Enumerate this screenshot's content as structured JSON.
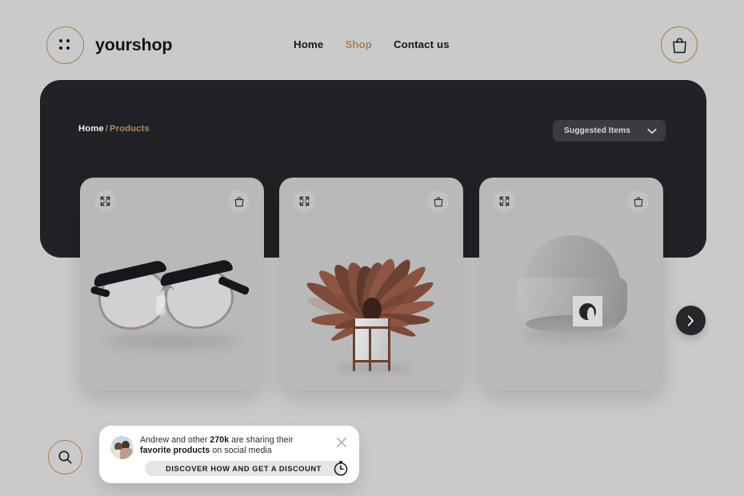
{
  "header": {
    "brand_name": "yourshop",
    "logo_icon": "four-dots-circle-icon",
    "nav": [
      {
        "label": "Home",
        "active": false
      },
      {
        "label": "Shop",
        "active": true
      },
      {
        "label": "Contact us",
        "active": false
      }
    ],
    "cart_icon": "shopping-bag-icon"
  },
  "panel": {
    "breadcrumb": {
      "home": "Home",
      "separator": "/",
      "current": "Products"
    },
    "sort_dropdown": {
      "selected": "Suggested Items",
      "chevron_icon": "chevron-down-icon"
    }
  },
  "products": [
    {
      "name": "eyeglasses",
      "expand_icon": "expand-arrows-icon",
      "cart_icon": "shopping-bag-icon"
    },
    {
      "name": "potted-plant",
      "expand_icon": "expand-arrows-icon",
      "cart_icon": "shopping-bag-icon"
    },
    {
      "name": "knit-beanie",
      "expand_icon": "expand-arrows-icon",
      "cart_icon": "shopping-bag-icon"
    }
  ],
  "carousel": {
    "next_icon": "chevron-right-icon"
  },
  "search": {
    "icon": "search-icon"
  },
  "toast": {
    "avatar_icon": "user-photo-avatar",
    "message_part1": "Andrew and other ",
    "message_count": "270k",
    "message_part2": " are sharing their ",
    "message_highlight": "favorite products",
    "message_part3": " on social media",
    "close_icon": "close-icon",
    "cta_label": "DISCOVER HOW AND GET A DISCOUNT",
    "timer_icon": "stopwatch-icon"
  },
  "colors": {
    "page_background": "#cacaca",
    "panel_dark": "#212126",
    "accent_tan": "#a87f52",
    "card_background": "#b9b9b9",
    "toast_background": "#ffffff"
  }
}
